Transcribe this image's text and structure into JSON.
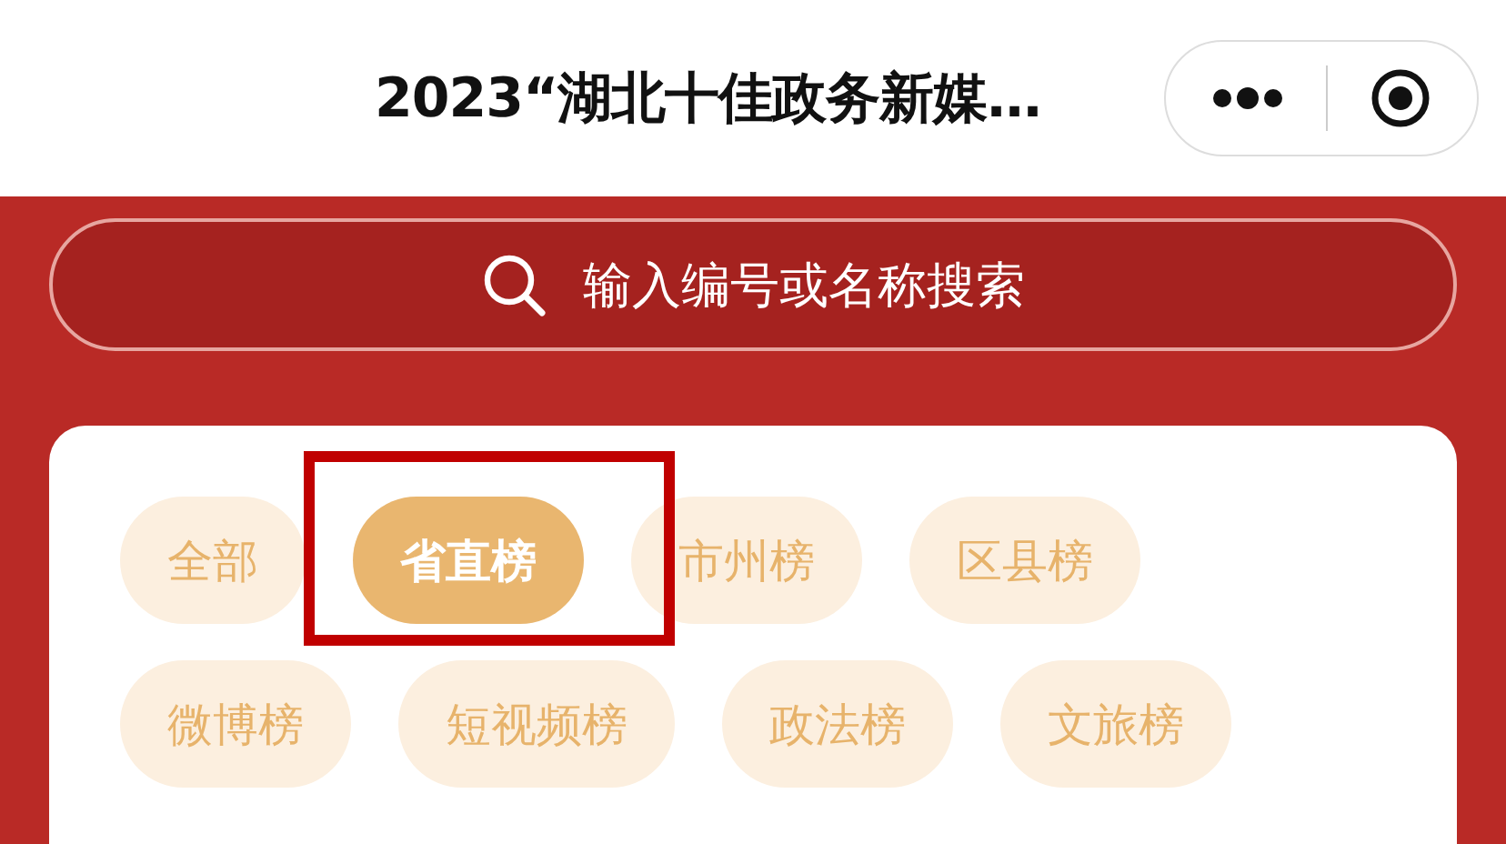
{
  "header": {
    "title": "2023“湖北十佳政务新媒…"
  },
  "search": {
    "placeholder": "输入编号或名称搜索"
  },
  "chips": [
    {
      "label": "全部",
      "selected": false
    },
    {
      "label": "省直榜",
      "selected": true
    },
    {
      "label": "市州榜",
      "selected": false
    },
    {
      "label": "区县榜",
      "selected": false
    },
    {
      "label": "微博榜",
      "selected": false
    },
    {
      "label": "短视频榜",
      "selected": false
    },
    {
      "label": "政法榜",
      "selected": false
    },
    {
      "label": "文旅榜",
      "selected": false
    }
  ]
}
